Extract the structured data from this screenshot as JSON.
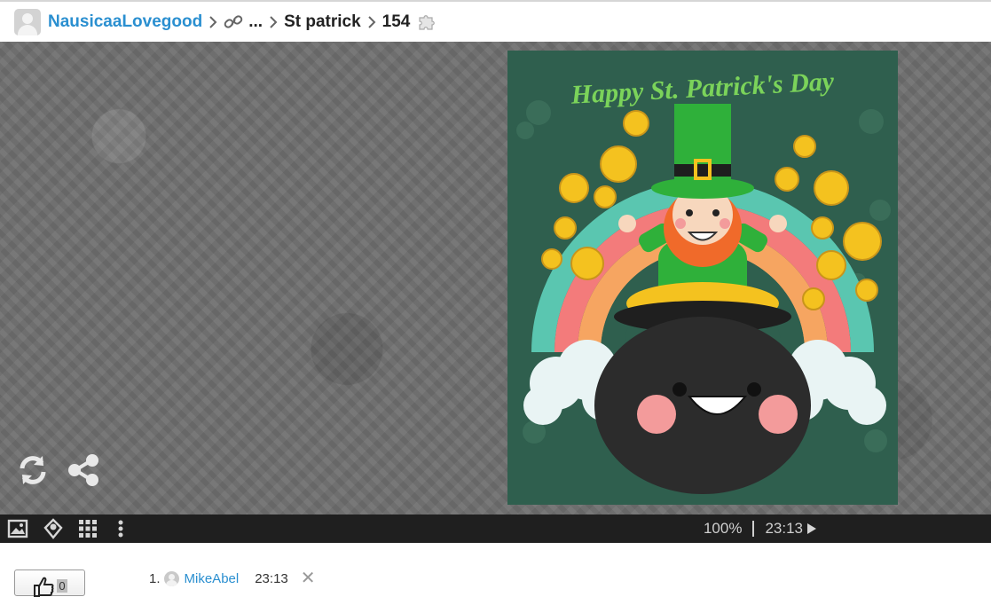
{
  "breadcrumb": {
    "user": "NausicaaLovegood",
    "ellipsis": "...",
    "collection": "St patrick",
    "piece_count": "154"
  },
  "artwork": {
    "title_text": "Happy St. Patrick's Day",
    "colors": {
      "background": "#2f5f4e",
      "title": "#7bd35a",
      "gold": "#f4c21f",
      "hat": "#2fb03a",
      "pot": "#2c2c2c",
      "beard": "#f06a2a"
    }
  },
  "stage": {
    "icons": [
      "refresh-icon",
      "share-icon"
    ]
  },
  "toolbar": {
    "icons": [
      "image-icon",
      "ghost-icon",
      "grid-icon",
      "more-icon"
    ],
    "zoom": "100%",
    "separator": "|",
    "time": "23:13",
    "play_icon": "play-icon"
  },
  "likes": {
    "count": "0",
    "icon": "thumbs-up-icon"
  },
  "comments": [
    {
      "number": "1.",
      "user": "MikeAbel",
      "time": "23:13",
      "close": "✕"
    }
  ]
}
